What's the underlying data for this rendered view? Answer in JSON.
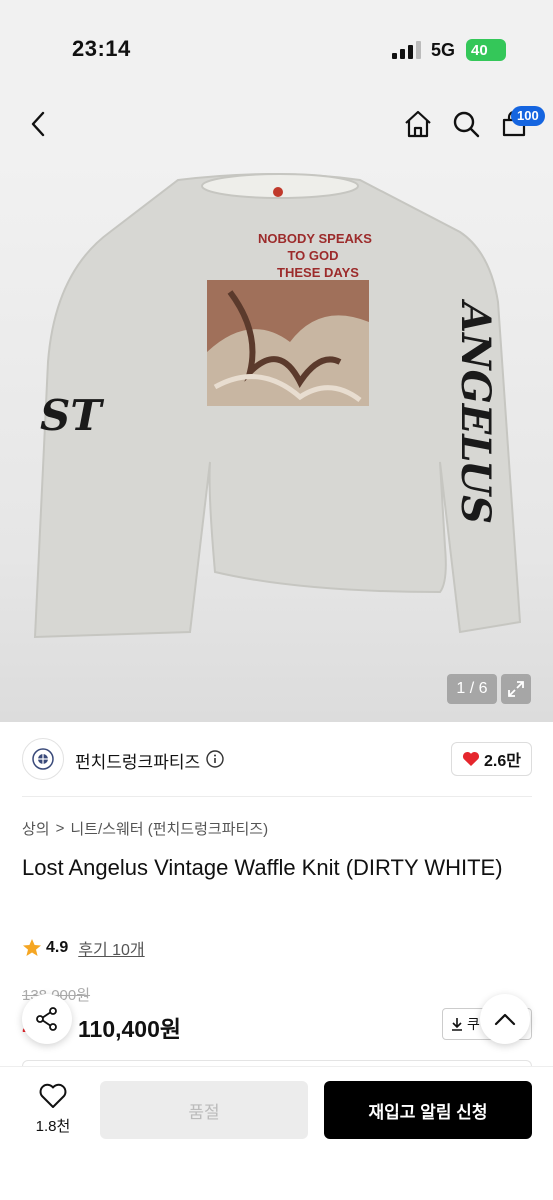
{
  "status": {
    "time": "23:14",
    "network": "5G",
    "battery": "40"
  },
  "nav": {
    "cart_count": "100"
  },
  "hero": {
    "graphic_text": [
      "NOBODY SPEAKS",
      "TO GOD",
      "THESE DAYS"
    ],
    "sleeve_left": "ST",
    "sleeve_right": "ANGELUS",
    "counter": "1 / 6"
  },
  "brand": {
    "name": "펀치드렁크파티즈",
    "likes": "2.6만"
  },
  "breadcrumb": {
    "category": "상의",
    "separator": ">",
    "subcategory": "니트/스웨터 (펀치드렁크파티즈)"
  },
  "product": {
    "title": "Lost Angelus Vintage Waffle Knit (DIRTY WHITE)"
  },
  "rating": {
    "value": "4.9",
    "reviews": "후기 10개"
  },
  "price": {
    "original": "138,000원",
    "discount": "2",
    "sale": "110,400원",
    "coupon_label": "쿠"
  },
  "bottom": {
    "wish_count": "1.8천",
    "soldout_label": "품절",
    "restock_label": "재입고 알림 신청"
  },
  "colors": {
    "accent_blue": "#1565e0",
    "discount_red": "#e5262d",
    "heart_red": "#e5262d",
    "star": "#f5a623"
  }
}
